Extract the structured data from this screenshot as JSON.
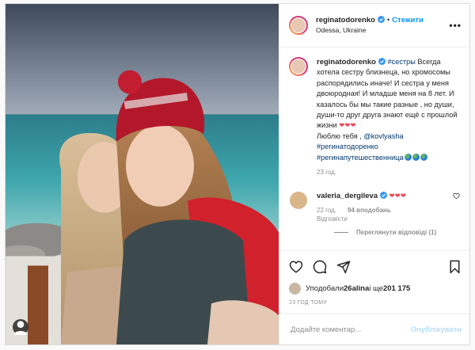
{
  "post": {
    "author": "reginatodorenko",
    "follow_label": "Стежити",
    "separator": "•",
    "location": "Odessa, Ukraine",
    "more_icon": "more-dots-icon",
    "caption": {
      "hashtag_sisters": "#сестры",
      "text_1": " Всегда хотела сестру близнеца, но хромосомы распорядились иначе! И сестра у меня двоюродная! И младше меня на 8 лет. И казалось бы мы такие разные , но души, души-то друг друга знают ещё с прошлой жизни ",
      "hearts_1": "❤❤❤",
      "text_2": "Люблю тебя , ",
      "mention": "@kovlyasha",
      "hashtag_2": "#регинатодоренко",
      "hashtag_3": "#регинапутешественница",
      "time": "23 год."
    },
    "comment": {
      "user": "valeria_dergileva",
      "hearts": "❤❤❤",
      "time": "22 год.",
      "likes": "94 вподобань",
      "reply_label": "Відповісти",
      "view_replies": "Переглянути відповіді (1)"
    },
    "liked_by_prefix": "Уподобали ",
    "liked_by_user": "26alina",
    "liked_by_middle": " і ще ",
    "liked_by_count": "201 175",
    "time_ago": "23 ГОД ТОМУ",
    "add_comment_placeholder": "Додайте коментар...",
    "publish_label": "Опублікувати"
  },
  "colors": {
    "accent": "#0095f6",
    "hashtag": "#00376b",
    "heart": "#ed4956",
    "muted": "#8e8e8e"
  }
}
